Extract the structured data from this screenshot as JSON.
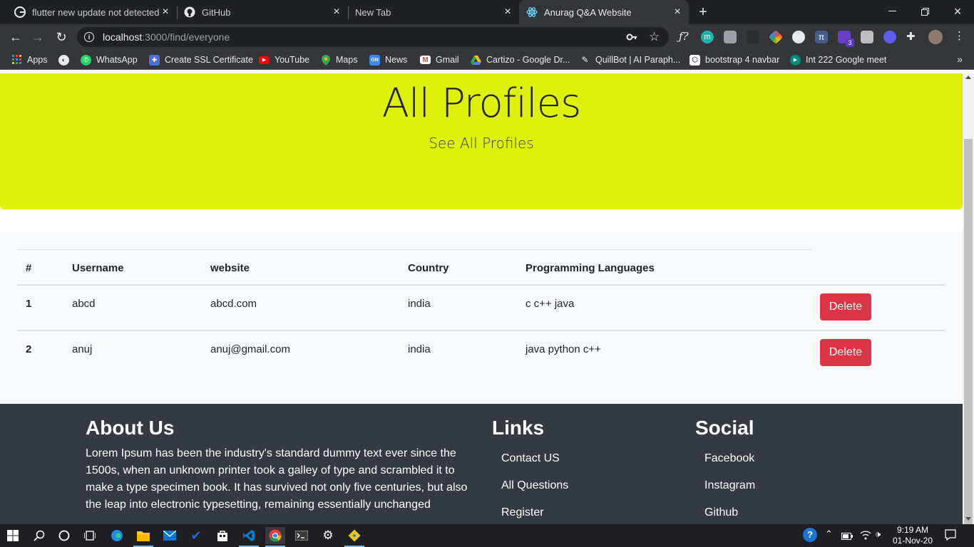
{
  "browser": {
    "tabs": [
      {
        "title": "flutter new update not detected",
        "favicon": "google-icon"
      },
      {
        "title": "GitHub",
        "favicon": "github-icon"
      },
      {
        "title": "New Tab",
        "favicon": ""
      },
      {
        "title": "Anurag Q&A Website",
        "favicon": "react-icon"
      }
    ],
    "url_host": "localhost",
    "url_path": ":3000/find/everyone",
    "bookmarks": [
      {
        "label": "Apps",
        "icon": "apps-grid-icon"
      },
      {
        "label": "",
        "icon": "globe-icon"
      },
      {
        "label": "WhatsApp",
        "icon": "whatsapp-icon"
      },
      {
        "label": "Create SSL Certificate",
        "icon": "puzzle-icon"
      },
      {
        "label": "YouTube",
        "icon": "youtube-icon"
      },
      {
        "label": "Maps",
        "icon": "maps-icon"
      },
      {
        "label": "News",
        "icon": "news-icon"
      },
      {
        "label": "Gmail",
        "icon": "gmail-icon"
      },
      {
        "label": "Cartizo - Google Dr...",
        "icon": "google-drive-icon"
      },
      {
        "label": "QuillBot | AI Paraph...",
        "icon": "quillbot-icon"
      },
      {
        "label": "bootstrap 4 navbar",
        "icon": "codepen-icon"
      },
      {
        "label": "Int 222 Google meet",
        "icon": "google-meet-icon"
      }
    ],
    "extension_badge": "3"
  },
  "hero": {
    "title": "All Profiles",
    "subtitle": "See All Profiles"
  },
  "table": {
    "headers": [
      "#",
      "Username",
      "website",
      "Country",
      "Programming Languages"
    ],
    "rows": [
      {
        "num": "1",
        "username": "abcd",
        "website": "abcd.com",
        "country": "india",
        "languages": "c c++ java",
        "action": "Delete"
      },
      {
        "num": "2",
        "username": "anuj",
        "website": "anuj@gmail.com",
        "country": "india",
        "languages": "java python c++",
        "action": "Delete"
      }
    ]
  },
  "footer": {
    "about_title": "About Us",
    "about_text": "Lorem Ipsum has been the industry's standard dummy text ever since the 1500s, when an unknown printer took a galley of type and scrambled it to make a type specimen book. It has survived not only five centuries, but also the leap into electronic typesetting, remaining essentially unchanged",
    "links_title": "Links",
    "links": [
      "Contact US",
      "All Questions",
      "Register"
    ],
    "social_title": "Social",
    "social": [
      "Facebook",
      "Instagram",
      "Github"
    ]
  },
  "taskbar": {
    "time": "9:19 AM",
    "date": "01-Nov-20"
  },
  "colors": {
    "hero_bg": "#dff10a",
    "delete_btn": "#dc3545",
    "footer_bg": "#343a40",
    "table_bg": "#f8f9fa"
  }
}
